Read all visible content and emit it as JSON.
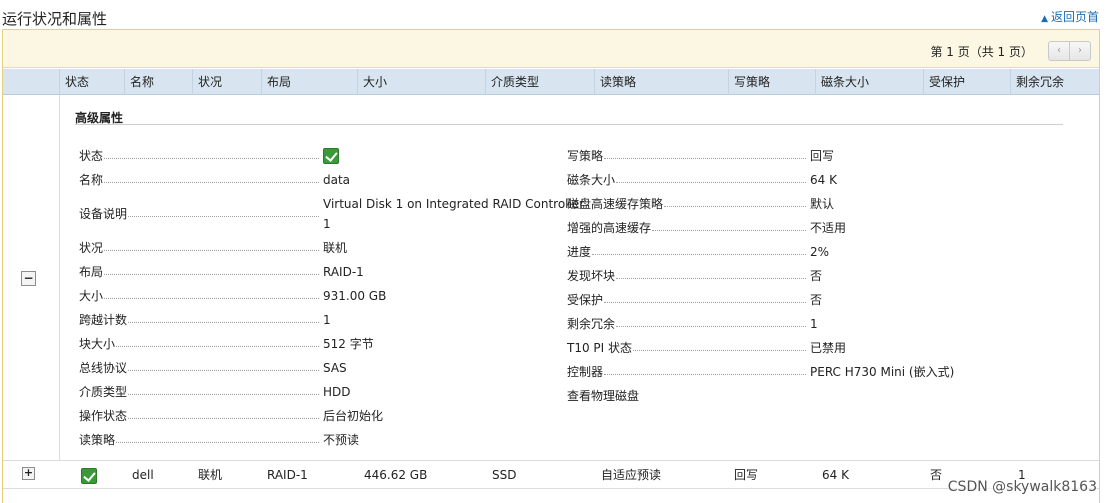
{
  "page": {
    "title": "运行状况和属性",
    "back_link": "返回页首"
  },
  "pager": {
    "text": "第 1 页（共 1 页）",
    "prev_icon": "‹",
    "next_icon": "›"
  },
  "columns": [
    "状态",
    "名称",
    "状况",
    "布局",
    "大小",
    "介质类型",
    "读策略",
    "写策略",
    "磁条大小",
    "受保护",
    "剩余冗余"
  ],
  "expanded": {
    "toggle": "−",
    "section_title": "高级属性",
    "left_props": [
      {
        "label": "状态",
        "value": "",
        "icon": "check-icon"
      },
      {
        "label": "名称",
        "value": "data"
      },
      {
        "label": "设备说明",
        "value_line1": "Virtual Disk 1 on Integrated RAID Controller",
        "value_line2": "1"
      },
      {
        "label": "状况",
        "value": "联机"
      },
      {
        "label": "布局",
        "value": "RAID-1"
      },
      {
        "label": "大小",
        "value": "931.00 GB"
      },
      {
        "label": "跨越计数",
        "value": "1"
      },
      {
        "label": "块大小",
        "value": "512 字节"
      },
      {
        "label": "总线协议",
        "value": "SAS"
      },
      {
        "label": "介质类型",
        "value": "HDD"
      },
      {
        "label": "操作状态",
        "value": "后台初始化"
      },
      {
        "label": "读策略",
        "value": "不预读"
      }
    ],
    "right_props": [
      {
        "label": "写策略",
        "value": "回写"
      },
      {
        "label": "磁条大小",
        "value": "64 K"
      },
      {
        "label": "磁盘高速缓存策略",
        "value": "默认"
      },
      {
        "label": "增强的高速缓存",
        "value": "不适用"
      },
      {
        "label": "进度",
        "value": "2%"
      },
      {
        "label": "发现坏块",
        "value": "否"
      },
      {
        "label": "受保护",
        "value": "否"
      },
      {
        "label": "剩余冗余",
        "value": "1"
      },
      {
        "label": "T10 PI 状态",
        "value": "已禁用"
      },
      {
        "label": "控制器",
        "value": "PERC H730 Mini (嵌入式)"
      }
    ],
    "view_disks_link": "查看物理磁盘"
  },
  "row2": {
    "toggle": "+",
    "status_icon": "check-icon",
    "name": "dell",
    "condition": "联机",
    "layout": "RAID-1",
    "size": "446.62 GB",
    "media": "SSD",
    "read_policy": "自适应预读",
    "write_policy": "回写",
    "stripe": "64 K",
    "protected": "否",
    "redundancy": "1"
  },
  "watermark": "CSDN @skywalk8163"
}
